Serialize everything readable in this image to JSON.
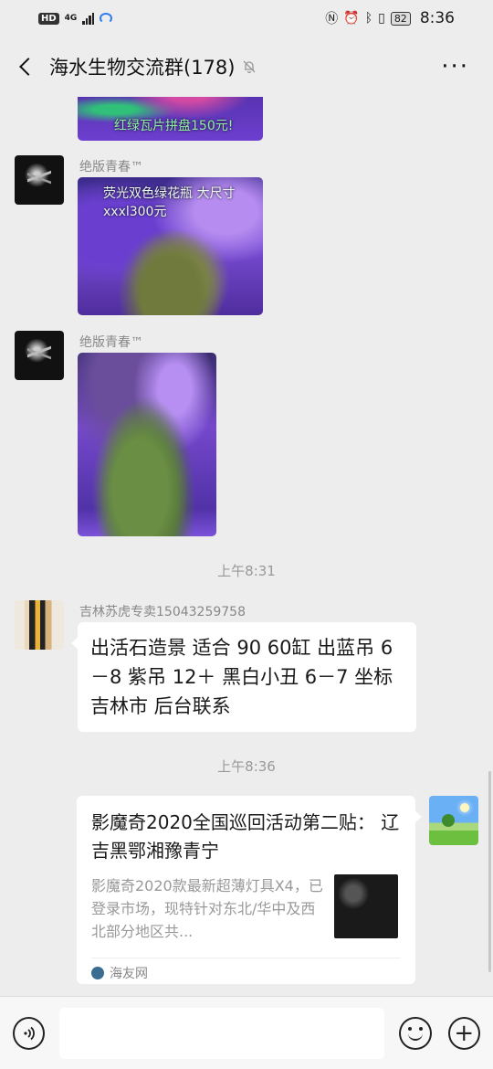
{
  "status_bar": {
    "hd": "HD",
    "network": "4G",
    "battery": "82",
    "time": "8:36",
    "icons": [
      "nfc-icon",
      "alarm-icon",
      "bluetooth-icon",
      "vibrate-icon"
    ]
  },
  "header": {
    "title": "海水生物交流群(178)",
    "more": "···"
  },
  "messages": [
    {
      "type": "image",
      "caption": "红绿瓦片拼盘150元!"
    },
    {
      "type": "image",
      "sender": "绝版青春™",
      "caption": "荧光双色绿花瓶 大尺寸xxxl300元"
    },
    {
      "type": "image",
      "sender": "绝版青春™"
    },
    {
      "type": "time",
      "text": "上午8:31"
    },
    {
      "type": "text",
      "sender": "吉林苏虎专卖15043259758",
      "text": "出活石造景 适合 90  60缸     出蓝吊 6－8  紫吊  12＋  黑白小丑 6－7  坐标吉林市   后台联系"
    },
    {
      "type": "time",
      "text": "上午8:36"
    },
    {
      "type": "link",
      "title": "影魔奇2020全国巡回活动第二贴：  辽吉黑鄂湘豫青宁",
      "description": "影魔奇2020款最新超薄灯具X4，已登录市场，现特针对东北/华中及西北部分地区共...",
      "source": "海友网"
    }
  ],
  "colors": {
    "background": "#ededed",
    "bubble": "#ffffff",
    "meta_text": "#999999"
  }
}
